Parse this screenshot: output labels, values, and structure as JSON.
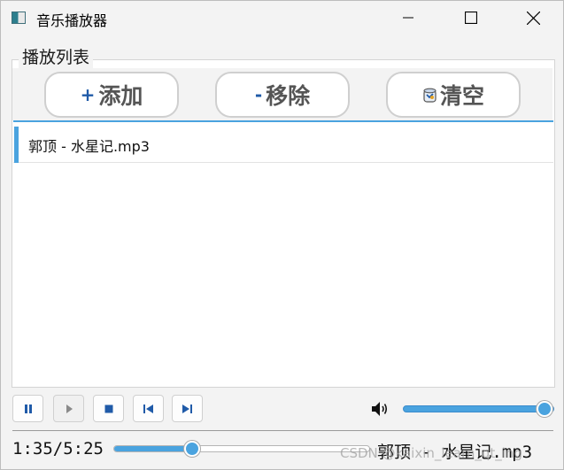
{
  "window": {
    "title": "音乐播放器"
  },
  "playlist": {
    "group_title": "播放列表",
    "add_label": "添加",
    "add_glyph": "+",
    "remove_label": "移除",
    "remove_glyph": "-",
    "clear_label": "清空",
    "clear_icon": "bin-icon",
    "items": [
      "郭顶 - 水星记.mp3"
    ],
    "selected_index": 0
  },
  "controls": {
    "pause_icon": "pause-icon",
    "play_icon": "play-icon",
    "stop_icon": "stop-icon",
    "prev_icon": "skip-previous-icon",
    "next_icon": "skip-next-icon",
    "volume_icon": "speaker-icon",
    "volume_level": 1.0
  },
  "status": {
    "time": "1:35/5:25",
    "progress_fraction": 0.292,
    "now_playing": "郭顶 - 水星记.mp3",
    "watermark": "CSDN @kaixin_learn_qt_ing"
  },
  "colors": {
    "accent": "#4aa3df",
    "glyph_blue": "#1f5aa8",
    "button_border": "#cfcfcf"
  }
}
